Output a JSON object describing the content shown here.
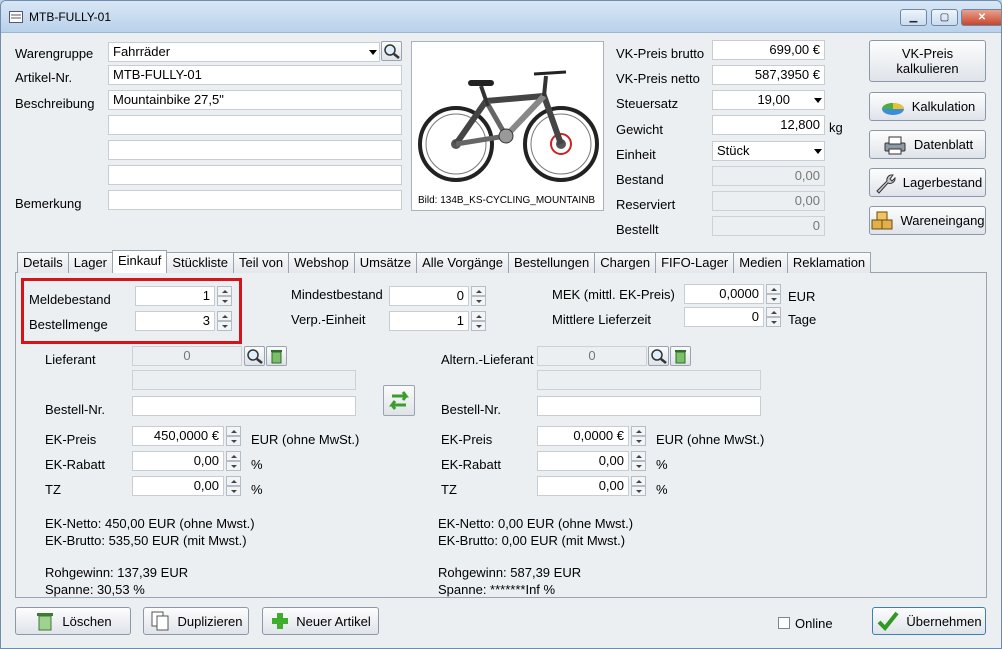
{
  "window": {
    "title": "MTB-FULLY-01",
    "minimize": "▁",
    "maximize": "▢",
    "close": "✕"
  },
  "article": {
    "warengruppe_label": "Warengruppe",
    "warengruppe_value": "Fahrräder",
    "artikelnr_label": "Artikel-Nr.",
    "artikelnr_value": "MTB-FULLY-01",
    "beschreibung_label": "Beschreibung",
    "beschreibung_value": "Mountainbike 27,5\"",
    "bemerkung_label": "Bemerkung"
  },
  "image": {
    "caption": "Bild: 134B_KS-CYCLING_MOUNTAINB"
  },
  "pricing": {
    "vk_brutto_label": "VK-Preis brutto",
    "vk_brutto_value": "699,00 €",
    "vk_netto_label": "VK-Preis netto",
    "vk_netto_value": "587,3950 €",
    "steuersatz_label": "Steuersatz",
    "steuersatz_value": "19,00",
    "gewicht_label": "Gewicht",
    "gewicht_value": "12,800",
    "gewicht_unit": "kg",
    "einheit_label": "Einheit",
    "einheit_value": "Stück",
    "bestand_label": "Bestand",
    "bestand_value": "0,00",
    "reserviert_label": "Reserviert",
    "reserviert_value": "0,00",
    "bestellt_label": "Bestellt",
    "bestellt_value": "0"
  },
  "side_buttons": {
    "vk_kalkulieren_1": "VK-Preis",
    "vk_kalkulieren_2": "kalkulieren",
    "kalkulation": "Kalkulation",
    "datenblatt": "Datenblatt",
    "lagerbestand": "Lagerbestand",
    "wareneingang": "Wareneingang"
  },
  "tabs": [
    "Details",
    "Lager",
    "Einkauf",
    "Stückliste",
    "Teil von",
    "Webshop",
    "Umsätze",
    "Alle Vorgänge",
    "Bestellungen",
    "Chargen",
    "FIFO-Lager",
    "Medien",
    "Reklamation"
  ],
  "einkauf": {
    "meldebestand_label": "Meldebestand",
    "meldebestand_value": "1",
    "bestellmenge_label": "Bestellmenge",
    "bestellmenge_value": "3",
    "mindestbestand_label": "Mindestbestand",
    "mindestbestand_value": "0",
    "verp_label": "Verp.-Einheit",
    "verp_value": "1",
    "mek_label": "MEK (mittl. EK-Preis)",
    "mek_value": "0,0000",
    "mek_unit": "EUR",
    "lieferzeit_label": "Mittlere Lieferzeit",
    "lieferzeit_value": "0",
    "lieferzeit_unit": "Tage",
    "left": {
      "lieferant_label": "Lieferant",
      "lieferant_value": "0",
      "bestellnr_label": "Bestell-Nr.",
      "ekpreis_label": "EK-Preis",
      "ekpreis_value": "450,0000 €",
      "ekpreis_unit": "EUR (ohne MwSt.)",
      "rabatt_label": "EK-Rabatt",
      "rabatt_value": "0,00",
      "rabatt_unit": "%",
      "tz_label": "TZ",
      "tz_value": "0,00",
      "tz_unit": "%",
      "netto": "EK-Netto: 450,00 EUR (ohne Mwst.)",
      "brutto": "EK-Brutto: 535,50 EUR (mit Mwst.)",
      "rohgewinn": "Rohgewinn: 137,39 EUR",
      "spanne": "Spanne: 30,53 %"
    },
    "right": {
      "lieferant_label": "Altern.-Lieferant",
      "lieferant_value": "0",
      "bestellnr_label": "Bestell-Nr.",
      "ekpreis_label": "EK-Preis",
      "ekpreis_value": "0,0000 €",
      "ekpreis_unit": "EUR (ohne MwSt.)",
      "rabatt_label": "EK-Rabatt",
      "rabatt_value": "0,00",
      "rabatt_unit": "%",
      "tz_label": "TZ",
      "tz_value": "0,00",
      "tz_unit": "%",
      "netto": "EK-Netto: 0,00 EUR (ohne Mwst.)",
      "brutto": "EK-Brutto: 0,00 EUR (mit Mwst.)",
      "rohgewinn": "Rohgewinn: 587,39 EUR",
      "spanne": "Spanne: *******Inf %"
    }
  },
  "footer": {
    "loeschen": "Löschen",
    "duplizieren": "Duplizieren",
    "neuer_artikel": "Neuer Artikel",
    "online": "Online",
    "uebernehmen": "Übernehmen"
  }
}
